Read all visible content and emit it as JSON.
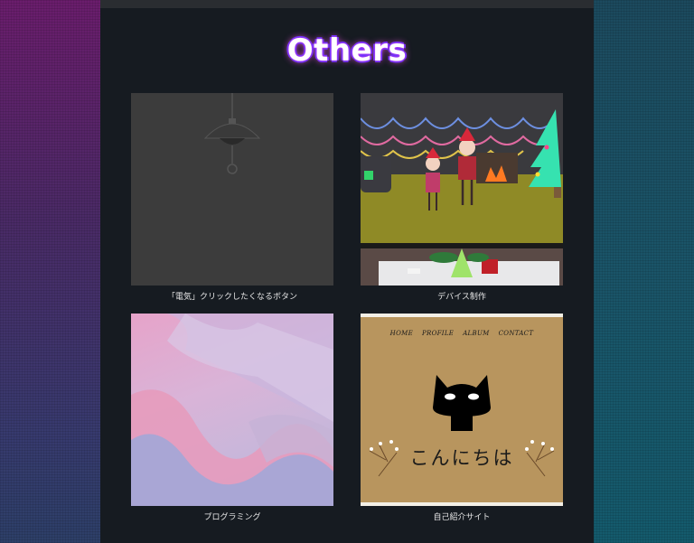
{
  "page": {
    "title": "Others"
  },
  "cards": [
    {
      "caption": "「電気」クリックしたくなるボタン",
      "thumb": "lamp-illustration"
    },
    {
      "caption": "デバイス制作",
      "thumb": "christmas-scene-photo"
    },
    {
      "caption": "プログラミング",
      "thumb": "pastel-wave-graphic"
    },
    {
      "caption": "自己紹介サイト",
      "thumb": "self-intro-site-preview",
      "site": {
        "nav": [
          "HOME",
          "PROFILE",
          "ALBUM",
          "CONTACT"
        ],
        "greeting": "こんにちは"
      }
    }
  ],
  "colors": {
    "panel": "#161b21",
    "title_glow": "#6633ff",
    "caption": "#e6e6e6"
  }
}
